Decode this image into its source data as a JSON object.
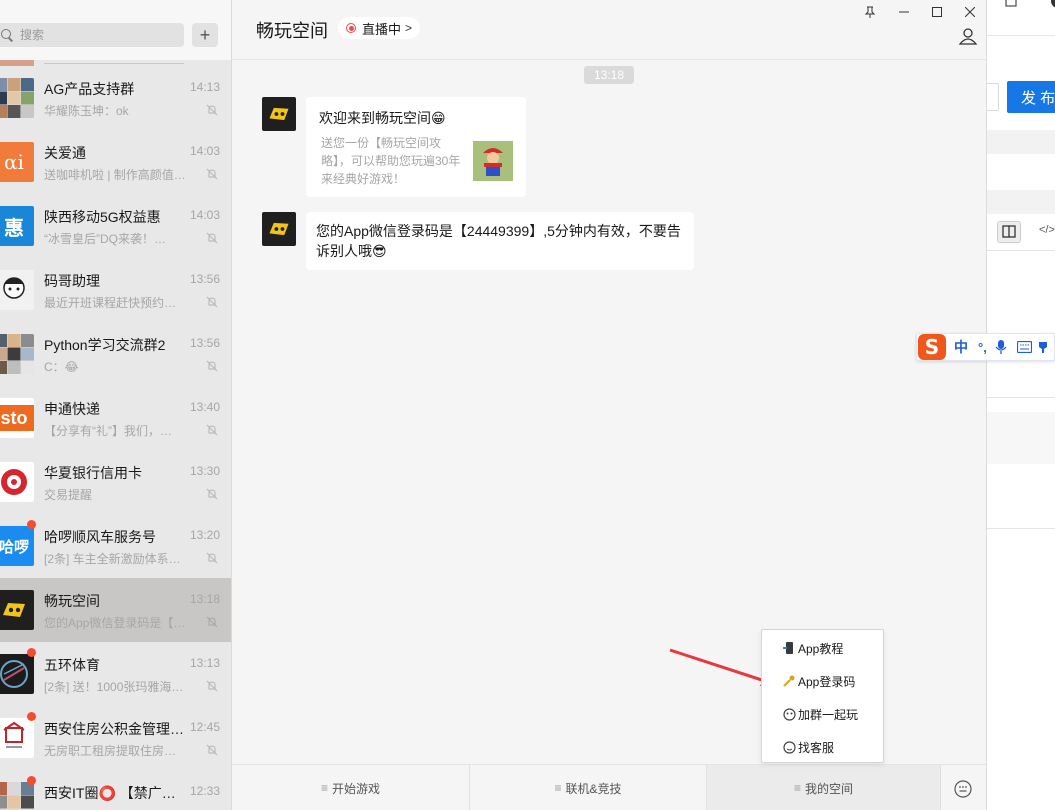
{
  "search": {
    "placeholder": "搜索"
  },
  "chats": [
    {
      "name": "AG产品支持群",
      "time": "14:13",
      "preview": "华耀陈玉坤：ok",
      "unread": false,
      "active": false,
      "avatar_style": "grid"
    },
    {
      "name": "关爱通",
      "time": "14:03",
      "preview": "送咖啡机啦 | 制作高颜值…",
      "unread": false,
      "active": false,
      "avatar_style": "guanai"
    },
    {
      "name": "陕西移动5G权益惠",
      "time": "14:03",
      "preview": "“冰雪皇后”DQ来袭！…",
      "unread": false,
      "active": false,
      "avatar_style": "hui"
    },
    {
      "name": "码哥助理",
      "time": "13:56",
      "preview": "最近开班课程赶快预约啦…",
      "unread": false,
      "active": false,
      "avatar_style": "mage"
    },
    {
      "name": "Python学习交流群2",
      "time": "13:56",
      "preview": "C：😂",
      "unread": false,
      "active": false,
      "avatar_style": "grid"
    },
    {
      "name": "申通快递",
      "time": "13:40",
      "preview": "【分享有“礼”】我们，…",
      "unread": false,
      "active": false,
      "avatar_style": "sto"
    },
    {
      "name": "华夏银行信用卡",
      "time": "13:30",
      "preview": "交易提醒",
      "unread": false,
      "active": false,
      "avatar_style": "huaxia"
    },
    {
      "name": "哈啰顺风车服务号",
      "time": "13:20",
      "preview": "[2条] 车主全新激励体系…",
      "unread": true,
      "active": false,
      "avatar_style": "hello"
    },
    {
      "name": "畅玩空间",
      "time": "13:18",
      "preview": "您的App微信登录码是【…",
      "unread": false,
      "active": true,
      "avatar_style": "game"
    },
    {
      "name": "五环体育",
      "time": "13:13",
      "preview": "[2条] 送！1000张玛雅海…",
      "unread": true,
      "active": false,
      "avatar_style": "wuhuan"
    },
    {
      "name": "西安住房公积金管理…",
      "time": "12:45",
      "preview": "无房职工租房提取住房公…",
      "unread": true,
      "active": false,
      "avatar_style": "gjj"
    },
    {
      "name": "西安IT圈⭕ 【禁广告…",
      "time": "12:33",
      "preview": "",
      "unread": true,
      "active": false,
      "avatar_style": "grid"
    }
  ],
  "header": {
    "title": "畅玩空间",
    "live_label": "直播中",
    "chevron": ">"
  },
  "conversation": {
    "timestamp": "13:18",
    "card": {
      "title": "欢迎来到畅玩空间😁",
      "description": "送您一份【畅玩空间攻略】，可以帮助您玩遍30年来经典好游戏！"
    },
    "message": "您的App微信登录码是【24449399】,5分钟内有效，不要告诉别人哦😎"
  },
  "bottom_menu": [
    {
      "label": "开始游戏",
      "active": false
    },
    {
      "label": "联机&竞技",
      "active": false
    },
    {
      "label": "我的空间",
      "active": true
    }
  ],
  "popup_menu": [
    {
      "label": "App教程",
      "icon": "phone-icon"
    },
    {
      "label": "App登录码",
      "icon": "key-icon"
    },
    {
      "label": "加群一起玩",
      "icon": "group-icon"
    },
    {
      "label": "找客服",
      "icon": "service-icon"
    }
  ],
  "right_window": {
    "publish_label": "发 布"
  },
  "ime": {
    "mode": "中",
    "punct": "°,"
  },
  "colors": {
    "accent_blue": "#1677e6",
    "arrow_red": "#e8383d",
    "unread_dot": "#f74c31",
    "active_row": "#c9c7c6"
  }
}
